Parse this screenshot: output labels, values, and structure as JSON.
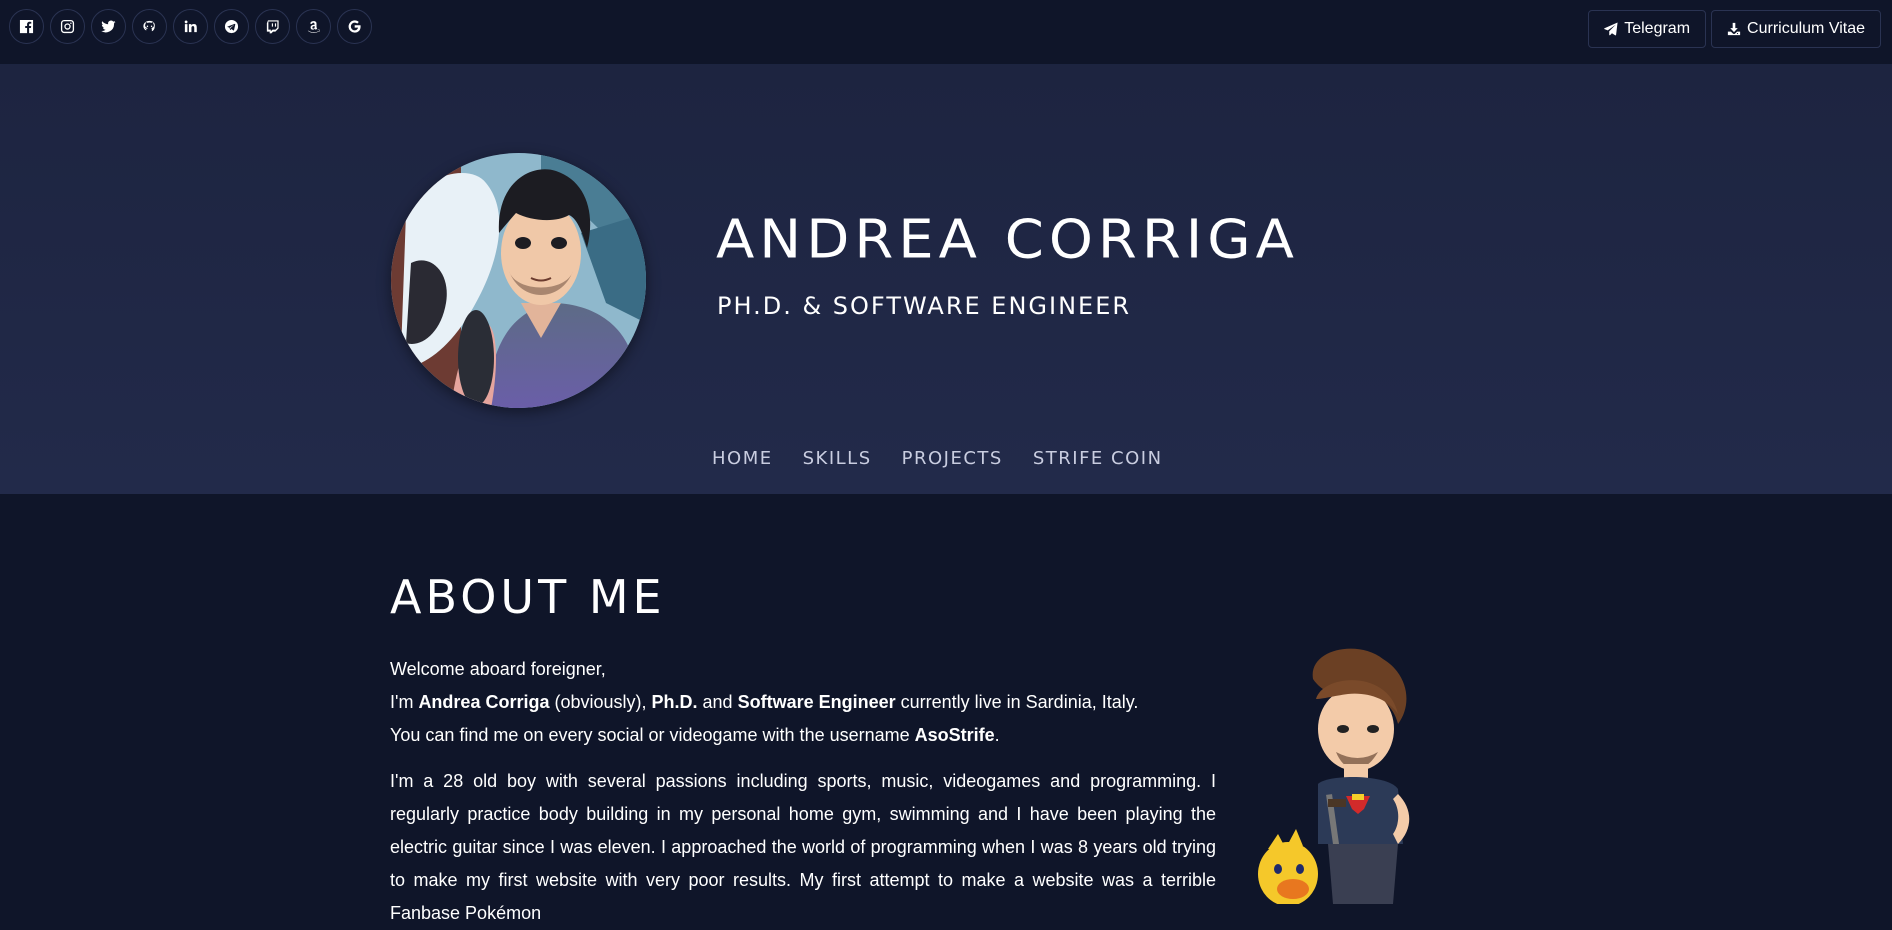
{
  "socials": [
    {
      "name": "facebook-icon"
    },
    {
      "name": "instagram-icon"
    },
    {
      "name": "twitter-icon"
    },
    {
      "name": "github-icon"
    },
    {
      "name": "linkedin-icon"
    },
    {
      "name": "telegram-icon"
    },
    {
      "name": "twitch-icon"
    },
    {
      "name": "amazon-icon"
    },
    {
      "name": "google-icon"
    }
  ],
  "topbar": {
    "telegram_label": "Telegram",
    "cv_label": "Curriculum Vitae"
  },
  "hero": {
    "name": "ANDREA CORRIGA",
    "subtitle": "PH.D. & SOFTWARE ENGINEER"
  },
  "nav": {
    "items": [
      "HOME",
      "SKILLS",
      "PROJECTS",
      "STRIFE COIN"
    ]
  },
  "about": {
    "title": "ABOUT ME",
    "greeting": "Welcome aboard foreigner,",
    "line2": {
      "pre": "I'm ",
      "name": "Andrea Corriga",
      "mid1": " (obviously), ",
      "phd": "Ph.D.",
      "mid2": " and ",
      "role": "Software Engineer",
      "post": " currently live in Sardinia, Italy."
    },
    "line3": {
      "pre": "You can find me on every social or videogame with the username ",
      "username": "AsoStrife",
      "post": "."
    },
    "bio": "I'm a 28 old boy with several passions including sports, music, videogames and programming. I regularly practice body building in my personal home gym, swimming and I have been playing the electric guitar since I was eleven. I approached the world of programming when I was 8 years old trying to make my first website with very poor results. My first attempt to make a website was a terrible Fanbase Pokémon"
  },
  "colors": {
    "page_bg": "#0f1529",
    "hero_bg": "#222a4a",
    "nav_text": "#c9cde0"
  }
}
